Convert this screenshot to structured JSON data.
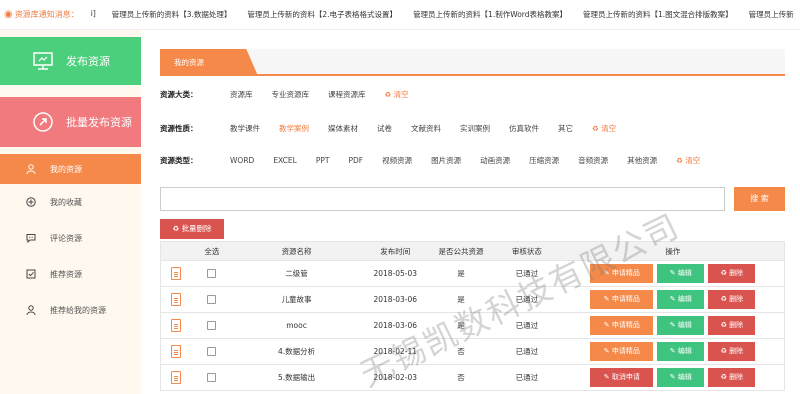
{
  "notice": {
    "label": "资源库通知消息：",
    "items": [
      "i]",
      "管理员上传新的资料【3.数据处理】",
      "管理员上传新的资料【2.电子表格格式设置】",
      "管理员上传新的资料【1.制作Word表格教案】",
      "管理员上传新的资料【1.图文混合排版教案】",
      "管理员上传新"
    ]
  },
  "sidebar": {
    "publish": "发布资源",
    "batch_publish": "批量发布资源",
    "menu": [
      {
        "label": "我的资源",
        "icon": "user-icon"
      },
      {
        "label": "我的收藏",
        "icon": "plus-circle-icon"
      },
      {
        "label": "评论资源",
        "icon": "comment-icon"
      },
      {
        "label": "推荐资源",
        "icon": "check-square-icon"
      },
      {
        "label": "推荐给我的资源",
        "icon": "user-icon"
      }
    ]
  },
  "main": {
    "tab": "我的资源",
    "filters": {
      "category": {
        "label": "资源大类：",
        "options": [
          "资源库",
          "专业资源库",
          "课程资源库"
        ],
        "clear": "清空"
      },
      "nature": {
        "label": "资源性质：",
        "options": [
          "教学课件",
          "教学案例",
          "媒体素材",
          "试卷",
          "文献资料",
          "实训案例",
          "仿真软件",
          "其它"
        ],
        "selected": "教学案例",
        "clear": "清空"
      },
      "type": {
        "label": "资源类型：",
        "options": [
          "WORD",
          "EXCEL",
          "PPT",
          "PDF",
          "视频资源",
          "图片资源",
          "动画资源",
          "压缩资源",
          "音频资源",
          "其他资源"
        ],
        "clear": "清空"
      }
    },
    "search_button": "搜 索",
    "bulk_delete": "批量删除",
    "table": {
      "headers": [
        "全选",
        "资源名称",
        "发布时间",
        "是否公共资源",
        "审核状态",
        "操作"
      ],
      "rows": [
        {
          "name": "二级管",
          "date": "2018-05-03",
          "public": "是",
          "status": "已通过",
          "action": "申请精品",
          "action_type": "apply"
        },
        {
          "name": "儿童故事",
          "date": "2018-03-06",
          "public": "是",
          "status": "已通过",
          "action": "申请精品",
          "action_type": "apply"
        },
        {
          "name": "mooc",
          "date": "2018-03-06",
          "public": "是",
          "status": "已通过",
          "action": "申请精品",
          "action_type": "apply"
        },
        {
          "name": "4.数据分析",
          "date": "2018-02-11",
          "public": "否",
          "status": "已通过",
          "action": "申请精品",
          "action_type": "apply"
        },
        {
          "name": "5.数据输出",
          "date": "2018-02-03",
          "public": "否",
          "status": "已通过",
          "action": "取消申请",
          "action_type": "cancel"
        }
      ],
      "edit_label": "编辑",
      "delete_label": "删除"
    },
    "watermark": "无锡凯数科技有限公司"
  },
  "colors": {
    "accent": "#f5894a",
    "green": "#4ccf7c",
    "pink": "#f07a7e",
    "red": "#d9534f"
  }
}
